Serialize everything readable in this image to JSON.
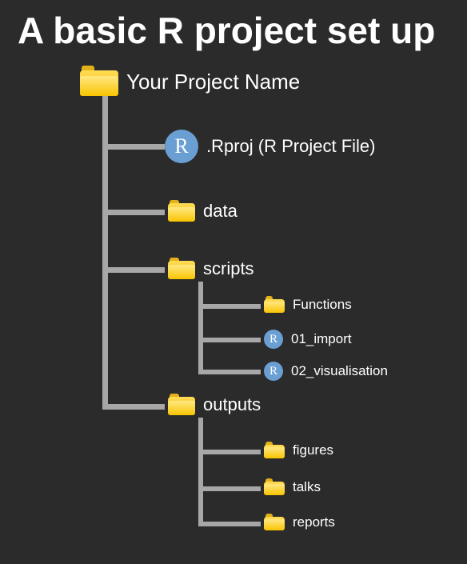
{
  "title": "A basic R project set up",
  "tree": {
    "root": "Your Project Name",
    "rproj": ".Rproj (R Project File)",
    "data": "data",
    "scripts": "scripts",
    "scripts_children": {
      "functions": "Functions",
      "import": "01_import",
      "visualisation": "02_visualisation"
    },
    "outputs": "outputs",
    "outputs_children": {
      "figures": "figures",
      "talks": "talks",
      "reports": "reports"
    }
  },
  "r_glyph": "R"
}
